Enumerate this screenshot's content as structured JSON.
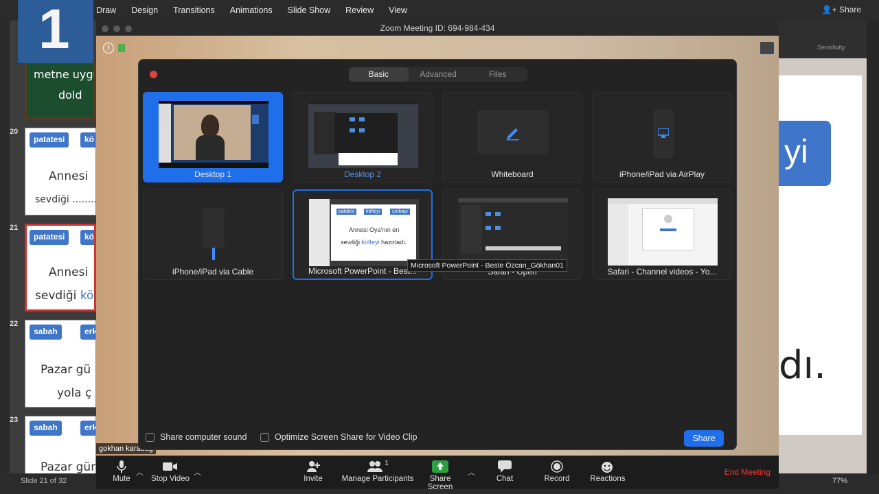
{
  "ppt": {
    "menu": [
      "Draw",
      "Design",
      "Transitions",
      "Animations",
      "Slide Show",
      "Review",
      "View"
    ],
    "share_label": "Share",
    "sensitivity_label": "Sensitivity",
    "tab_badge": "1",
    "status_text": "Slide 21 of 32",
    "zoom_percent": "77%",
    "slides": [
      {
        "number": "20",
        "chips": [
          "patatesi",
          "kö"
        ],
        "lines": [
          "Annesi",
          "sevdiği ........"
        ]
      },
      {
        "number": "21",
        "chips": [
          "patatesi",
          "kö"
        ],
        "lines": [
          "Annesi",
          "sevdiği"
        ],
        "highlight": "köf"
      },
      {
        "number": "22",
        "chips": [
          "sabah",
          "erk"
        ],
        "lines": [
          "Pazar gü",
          "yola ç"
        ]
      },
      {
        "number": "23",
        "chips": [
          "sabah",
          "erk"
        ],
        "lines": [
          "Pazar gün"
        ]
      }
    ],
    "top_slide_lines": [
      "metne uygu",
      "dold"
    ],
    "slide_fragment_text": "yi",
    "slide_big_text": "dı."
  },
  "zoom": {
    "title": "Zoom Meeting ID: 694-984-434",
    "name_tag": "gokhan karadag",
    "toolbar": {
      "mute": "Mute",
      "stop_video": "Stop Video",
      "invite": "Invite",
      "manage_participants": "Manage Participants",
      "participant_count": "1",
      "share_screen": "Share Screen",
      "chat": "Chat",
      "record": "Record",
      "reactions": "Reactions",
      "end_meeting": "End Meeting"
    },
    "share_dialog": {
      "tabs": [
        "Basic",
        "Advanced",
        "Files"
      ],
      "selected_tab": "Basic",
      "options": [
        {
          "label": "Desktop 1"
        },
        {
          "label": "Desktop 2"
        },
        {
          "label": "Whiteboard"
        },
        {
          "label": "iPhone/iPad via AirPlay"
        },
        {
          "label": "iPhone/iPad via Cable"
        },
        {
          "label": "Microsoft PowerPoint - Best..."
        },
        {
          "label": "Safari - Open"
        },
        {
          "label": "Safari - Channel videos - Yo..."
        }
      ],
      "selected_option": "Desktop 1",
      "tooltip": "Microsoft PowerPoint - Beste Özcan_Gökhan01",
      "ppt_preview_chips": [
        "patates",
        "köfteyi",
        "çorbayı"
      ],
      "ppt_preview_lines": [
        "Annesi Oya'nın en",
        "sevdiği",
        "köfteyi",
        "hazırladı."
      ],
      "share_computer_sound": "Share computer sound",
      "optimize_video": "Optimize Screen Share for Video Clip",
      "share_button": "Share"
    }
  },
  "colors": {
    "zoom_blue": "#1f6feb",
    "end_red": "#e53935",
    "chip_blue": "#3f76c9"
  }
}
